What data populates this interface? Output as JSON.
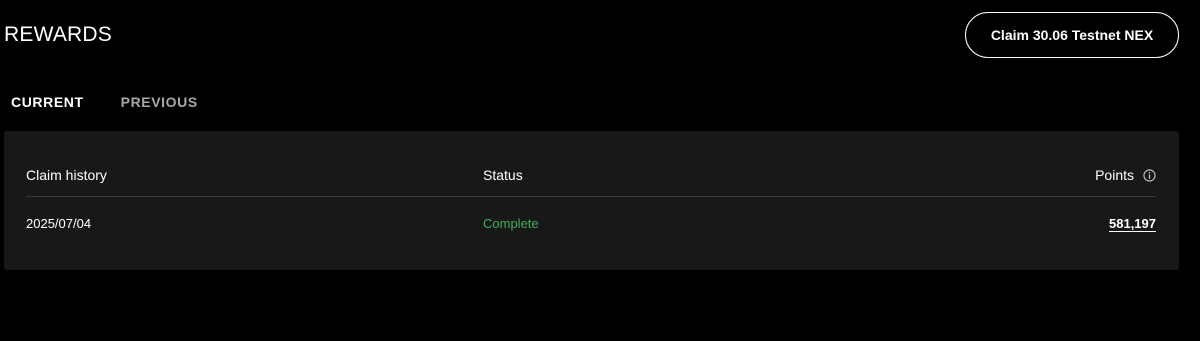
{
  "header": {
    "title": "REWARDS",
    "claim_button_label": "Claim 30.06 Testnet NEX"
  },
  "tabs": [
    {
      "label": "CURRENT",
      "active": true
    },
    {
      "label": "PREVIOUS",
      "active": false
    }
  ],
  "table": {
    "columns": [
      "Claim history",
      "Status",
      "Points"
    ],
    "rows": [
      {
        "date": "2025/07/04",
        "status": "Complete",
        "points": "581,197"
      }
    ]
  },
  "icons": {
    "points_info": "info-icon"
  },
  "colors": {
    "background": "#000000",
    "panel": "#181818",
    "status_complete": "#3fae5b",
    "inactive_tab": "#a8a8a8"
  }
}
